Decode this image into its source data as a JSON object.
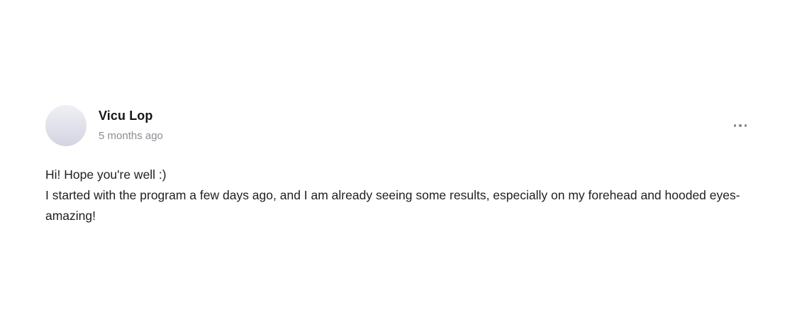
{
  "post": {
    "author": "Vicu Lop",
    "timestamp": "5 months ago",
    "avatar_colors": [
      "#f0f0f4",
      "#d3d4e2"
    ],
    "menu_icon": "more-horizontal-icon",
    "body": {
      "line1": "Hi! Hope you're well :)",
      "line2": "I started with the program a few days ago, and I am already seeing some results, especially on my forehead and hooded eyes- amazing!"
    }
  }
}
